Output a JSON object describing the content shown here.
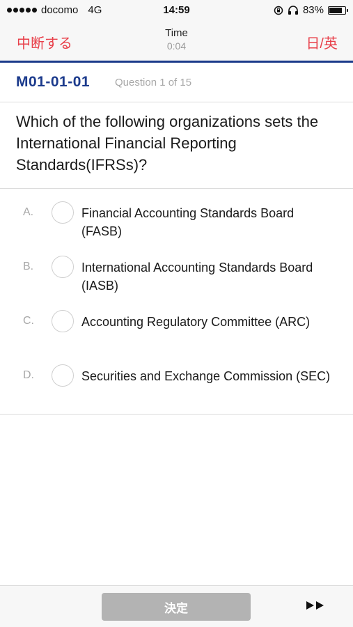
{
  "status_bar": {
    "carrier": "docomo",
    "network": "4G",
    "time": "14:59",
    "battery": "83%",
    "battery_level": 0.83
  },
  "nav": {
    "left_label": "中断する",
    "time_label": "Time",
    "time_value": "0:04",
    "right_label": "日/英"
  },
  "question": {
    "id": "M01-01-01",
    "counter": "Question 1 of 15",
    "text": "Which of the following organizations sets the International Financial Reporting Standards(IFRSs)?"
  },
  "options": [
    {
      "letter": "A.",
      "text": "Financial Accounting Standards Board (FASB)"
    },
    {
      "letter": "B.",
      "text": "International Accounting Standards Board (IASB)"
    },
    {
      "letter": "C.",
      "text": "Accounting Regulatory Committee (ARC)"
    },
    {
      "letter": "D.",
      "text": "Securities and Exchange Commission (SEC)"
    }
  ],
  "toolbar": {
    "decide_label": "決定",
    "skip_icon": "fast-forward-icon"
  },
  "colors": {
    "accent_red": "#e8404a",
    "brand_blue": "#1b3a8c",
    "disabled_button": "#b3b3b3"
  }
}
